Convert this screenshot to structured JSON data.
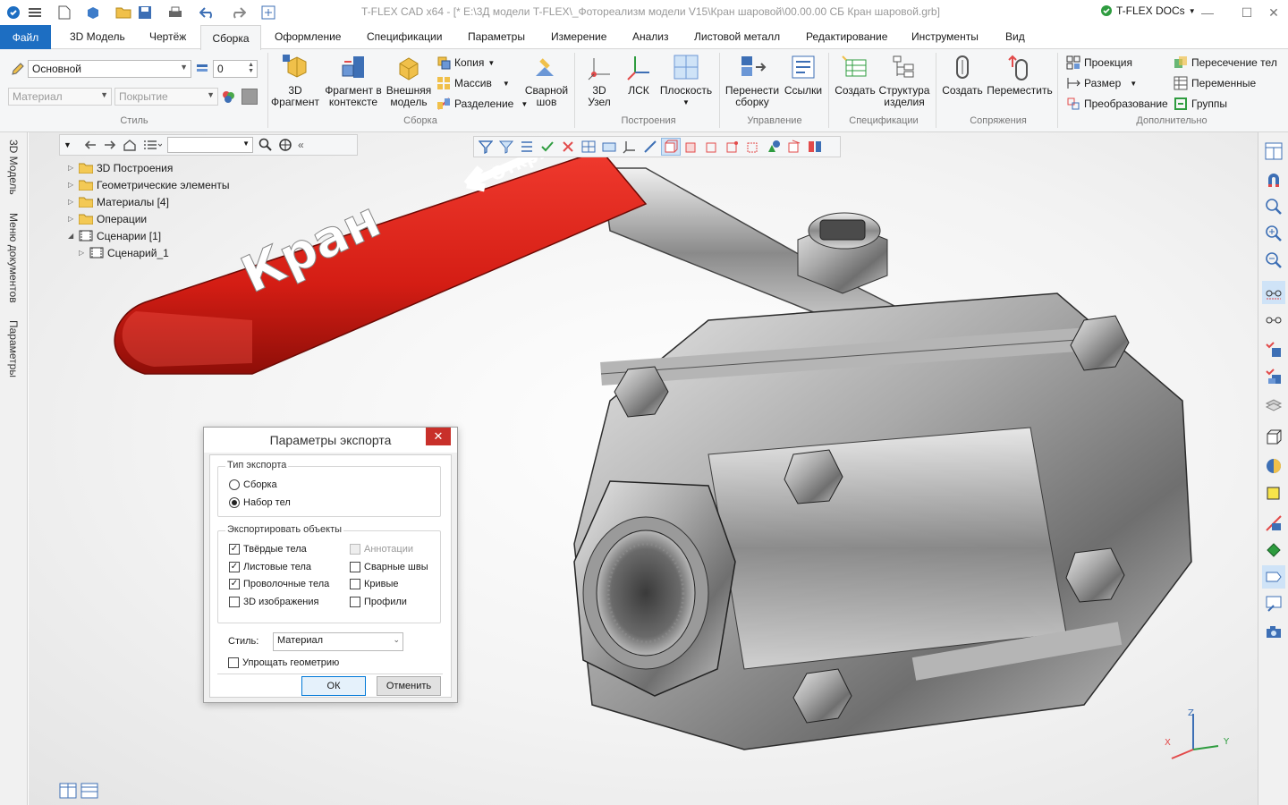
{
  "window": {
    "title": "T-FLEX CAD x64 - [* E:\\3Д модели T-FLEX\\_Фотореализм модели V15\\Кран шаровой\\00.00.00 СБ Кран шаровой.grb]",
    "docs_label": "T-FLEX DOCs"
  },
  "menu": {
    "tabs": [
      "Файл",
      "3D Модель",
      "Чертёж",
      "Сборка",
      "Оформление",
      "Спецификации",
      "Параметры",
      "Измерение",
      "Анализ",
      "Листовой металл",
      "Редактирование",
      "Инструменты",
      "Вид"
    ],
    "active": "Сборка"
  },
  "ribbon": {
    "style_group": {
      "label": "Стиль",
      "layer_value": "Основной",
      "level_value": "0",
      "material_placeholder": "Материал",
      "coating_placeholder": "Покрытие"
    },
    "assembly_group": {
      "label": "Сборка",
      "fragment_3d": "3D\nФрагмент",
      "fragment_ctx": "Фрагмент в\nконтексте",
      "external_model": "Внешняя\nмодель",
      "copy": "Копия",
      "array": "Массив",
      "split": "Разделение",
      "weld": "Сварной\nшов"
    },
    "constructions_group": {
      "label": "Построения",
      "node3d": "3D\nУзел",
      "lcs": "ЛСК",
      "plane": "Плоскость"
    },
    "control_group": {
      "label": "Управление",
      "move_assembly": "Перенести\nсборку",
      "links": "Ссылки"
    },
    "spec_group": {
      "label": "Спецификации",
      "create": "Создать",
      "structure": "Структура\nизделия"
    },
    "mates_group": {
      "label": "Сопряжения",
      "create": "Создать",
      "move": "Переместить"
    },
    "extra_group": {
      "label": "Дополнительно",
      "projection": "Проекция",
      "dimension": "Размер",
      "transform": "Преобразование",
      "body_intersection": "Пересечение тел",
      "variables": "Переменные",
      "groups": "Группы"
    }
  },
  "left_tabs": [
    "3D Модель",
    "Меню документов",
    "Параметры"
  ],
  "tree": {
    "nodes": [
      {
        "label": "3D Построения",
        "icon": "folder-icon"
      },
      {
        "label": "Геометрические элементы",
        "icon": "folder-icon"
      },
      {
        "label": "Материалы [4]",
        "icon": "folder-icon"
      },
      {
        "label": "Операции",
        "icon": "folder-icon"
      },
      {
        "label": "Сценарии [1]",
        "icon": "scenario-icon"
      },
      {
        "label": "Сценарий_1",
        "icon": "scenario-icon"
      }
    ]
  },
  "model": {
    "handle_text": "Кран",
    "handle_small_text": "Откр."
  },
  "dialog": {
    "title": "Параметры экспорта",
    "export_type_legend": "Тип экспорта",
    "radio_assembly": "Сборка",
    "radio_bodies": "Набор тел",
    "radio_selected": "bodies",
    "objects_legend": "Экспортировать объекты",
    "solid_bodies": "Твёрдые тела",
    "sheet_bodies": "Листовые тела",
    "wire_bodies": "Проволочные тела",
    "images_3d": "3D изображения",
    "annotations": "Аннотации",
    "welds": "Сварные швы",
    "curves": "Кривые",
    "profiles": "Профили",
    "style_label": "Стиль:",
    "style_value": "Материал",
    "simplify": "Упрощать геометрию",
    "ok": "ОК",
    "cancel": "Отменить"
  },
  "axes": {
    "x": "X",
    "y": "Y",
    "z": "Z"
  }
}
